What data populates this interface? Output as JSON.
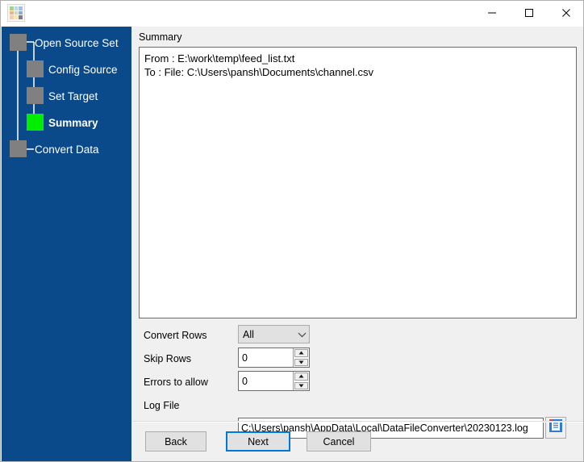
{
  "window": {
    "title": "",
    "app_icon": "table-grid-icon",
    "controls": {
      "minimize": "minimize-icon",
      "maximize": "maximize-icon",
      "close": "close-icon"
    }
  },
  "sidebar": {
    "background_color": "#0b4a8a",
    "node_color": "#808080",
    "active_node_color": "#00ee00",
    "steps": [
      {
        "label": "Open Source Set",
        "state": "done",
        "indent": "outer"
      },
      {
        "label": "Config Source",
        "state": "done",
        "indent": "inner"
      },
      {
        "label": "Set Target",
        "state": "done",
        "indent": "inner"
      },
      {
        "label": "Summary",
        "state": "current",
        "indent": "inner"
      },
      {
        "label": "Convert Data",
        "state": "pending",
        "indent": "outer"
      }
    ]
  },
  "main": {
    "group_label": "Summary",
    "summary_lines": [
      "From : E:\\work\\temp\\feed_list.txt",
      "To : File: C:\\Users\\pansh\\Documents\\channel.csv"
    ],
    "fields": {
      "convert_rows": {
        "label": "Convert Rows",
        "value": "All",
        "options": [
          "All"
        ]
      },
      "skip_rows": {
        "label": "Skip Rows",
        "value": "0"
      },
      "errors_to_allow": {
        "label": "Errors to allow",
        "value": "0"
      },
      "log_file": {
        "label": "Log File",
        "value": "C:\\Users\\pansh\\AppData\\Local\\DataFileConverter\\20230123.log",
        "browse_icon": "document-browse-icon"
      }
    },
    "buttons": {
      "back": "Back",
      "next": "Next",
      "cancel": "Cancel",
      "focused": "Next",
      "focus_color": "#0078d7"
    }
  }
}
